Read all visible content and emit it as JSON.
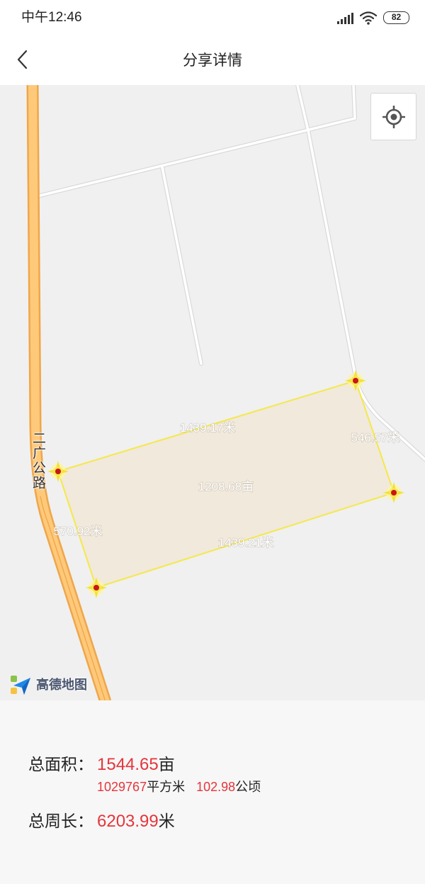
{
  "status_bar": {
    "time": "中午12:46",
    "battery": "82",
    "icons": [
      "signal-icon",
      "wifi-icon",
      "battery-icon"
    ]
  },
  "header": {
    "title": "分享详情",
    "back_icon": "chevron-left-icon"
  },
  "map": {
    "road_label": "二广公路",
    "plot": {
      "area": "1208.68亩",
      "edge_top": "1439.17米",
      "edge_right": "546.57米",
      "edge_bottom": "1439.21米",
      "edge_left": "570.92米"
    },
    "locate_icon": "crosshair-icon",
    "logo_icon": "amap-logo-icon",
    "logo_text": "高德地图"
  },
  "summary": {
    "area": {
      "label": "总面积：",
      "mu": "1544.65",
      "mu_unit": "亩",
      "sqm": "1029767",
      "sqm_unit": "平方米",
      "ha": "102.98",
      "ha_unit": "公顷"
    },
    "perimeter": {
      "label": "总周长：",
      "value": "6203.99",
      "unit": "米"
    }
  },
  "colors": {
    "accent_red": "#e5353b",
    "plot_fill": "#f1e8da",
    "plot_border": "#f5e84a",
    "vertex_dot": "#c8161d",
    "highway": "#ffc97a",
    "map_background": "#f0f0f0"
  }
}
